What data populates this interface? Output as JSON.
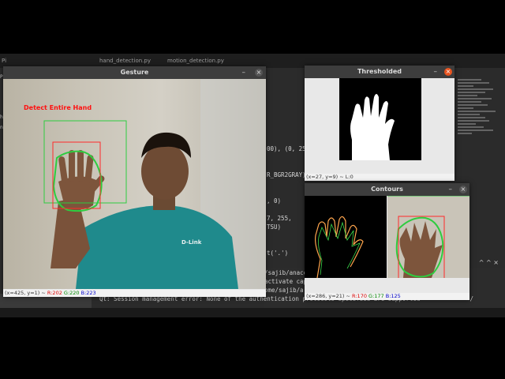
{
  "ide": {
    "tabs": [
      "Pi",
      "hand_detection.py",
      "motion_detection.py"
    ],
    "left_chars": [
      "Pi",
      "h",
      "n"
    ],
    "code_lines": [
      "00), (0, 25",
      "",
      "",
      "R_BGR2GRAY)",
      "",
      "",
      ", 0)",
      "",
      "7, 255,",
      "TSU)",
      "",
      "",
      "t('.')"
    ],
    "terminal_lines": [
      "/sajib/anaco",
      " activate cap",
      "ome/sajib/a",
      "/"
    ],
    "terminal_right": "^ ^ ⨯",
    "qt_message": "Qt: Session management error: None of the authentication protocols specified are supported"
  },
  "gesture_window": {
    "title": "Gesture",
    "overlay_text": "Detect Entire Hand",
    "status_prefix": "(x=425, y=1) ~ ",
    "status_r": "R:202",
    "status_g": "G:220",
    "status_b": "B:223",
    "shirt_text": "D-Link",
    "minimize_label": "–",
    "close_label": "×"
  },
  "thresholded_window": {
    "title": "Thresholded",
    "status_text": "(x=27, y=9) ~ L:0",
    "minimize_label": "–",
    "close_label": "×"
  },
  "contours_window": {
    "title": "Contours",
    "status_prefix": "(x=286, y=21) ~ ",
    "status_r": "R:170",
    "status_g": "G:177",
    "status_b": "B:125",
    "minimize_label": "–",
    "close_label": "×"
  },
  "colors": {
    "overlay_red": "#ff1010",
    "green_box": "#2ecc40",
    "red_box": "#ff2a2a",
    "close_active": "#e95420"
  }
}
